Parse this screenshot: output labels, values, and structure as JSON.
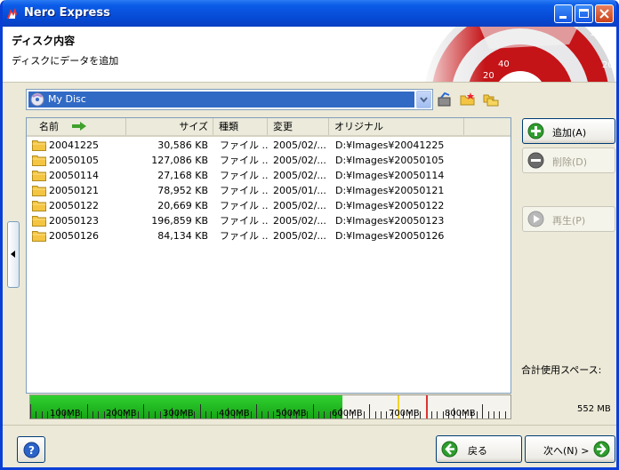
{
  "window": {
    "title": "Nero Express"
  },
  "header": {
    "title": "ディスク内容",
    "subtitle": "ディスクにデータを追加"
  },
  "disc": {
    "name": "My Disc"
  },
  "columns": {
    "name": "名前",
    "size": "サイズ",
    "type": "種類",
    "modified": "変更",
    "original": "オリジナル"
  },
  "rows": [
    {
      "name": "20041225",
      "size": "30,586 KB",
      "type": "ファイル ...",
      "modified": "2005/02/...",
      "original": "D:¥Images¥20041225"
    },
    {
      "name": "20050105",
      "size": "127,086 KB",
      "type": "ファイル ...",
      "modified": "2005/02/...",
      "original": "D:¥Images¥20050105"
    },
    {
      "name": "20050114",
      "size": "27,168 KB",
      "type": "ファイル ...",
      "modified": "2005/02/...",
      "original": "D:¥Images¥20050114"
    },
    {
      "name": "20050121",
      "size": "78,952 KB",
      "type": "ファイル ...",
      "modified": "2005/01/...",
      "original": "D:¥Images¥20050121"
    },
    {
      "name": "20050122",
      "size": "20,669 KB",
      "type": "ファイル ...",
      "modified": "2005/02/...",
      "original": "D:¥Images¥20050122"
    },
    {
      "name": "20050123",
      "size": "196,859 KB",
      "type": "ファイル ...",
      "modified": "2005/02/...",
      "original": "D:¥Images¥20050123"
    },
    {
      "name": "20050126",
      "size": "84,134 KB",
      "type": "ファイル ...",
      "modified": "2005/02/...",
      "original": "D:¥Images¥20050126"
    }
  ],
  "buttons": {
    "add": "追加(A)",
    "delete": "削除(D)",
    "play": "再生(P)",
    "back": "戻る",
    "next": "次へ(N) >"
  },
  "usage": {
    "label": "合計使用スペース:",
    "value": "552 MB",
    "used_mb": 552,
    "scale_labels": [
      "100MB",
      "200MB",
      "300MB",
      "400MB",
      "500MB",
      "600MB",
      "700MB",
      "800MB"
    ]
  },
  "colors": {
    "titlebar": "#0a5ce8",
    "selection": "#316ac5",
    "capacity_fill": "#1fb51f"
  }
}
